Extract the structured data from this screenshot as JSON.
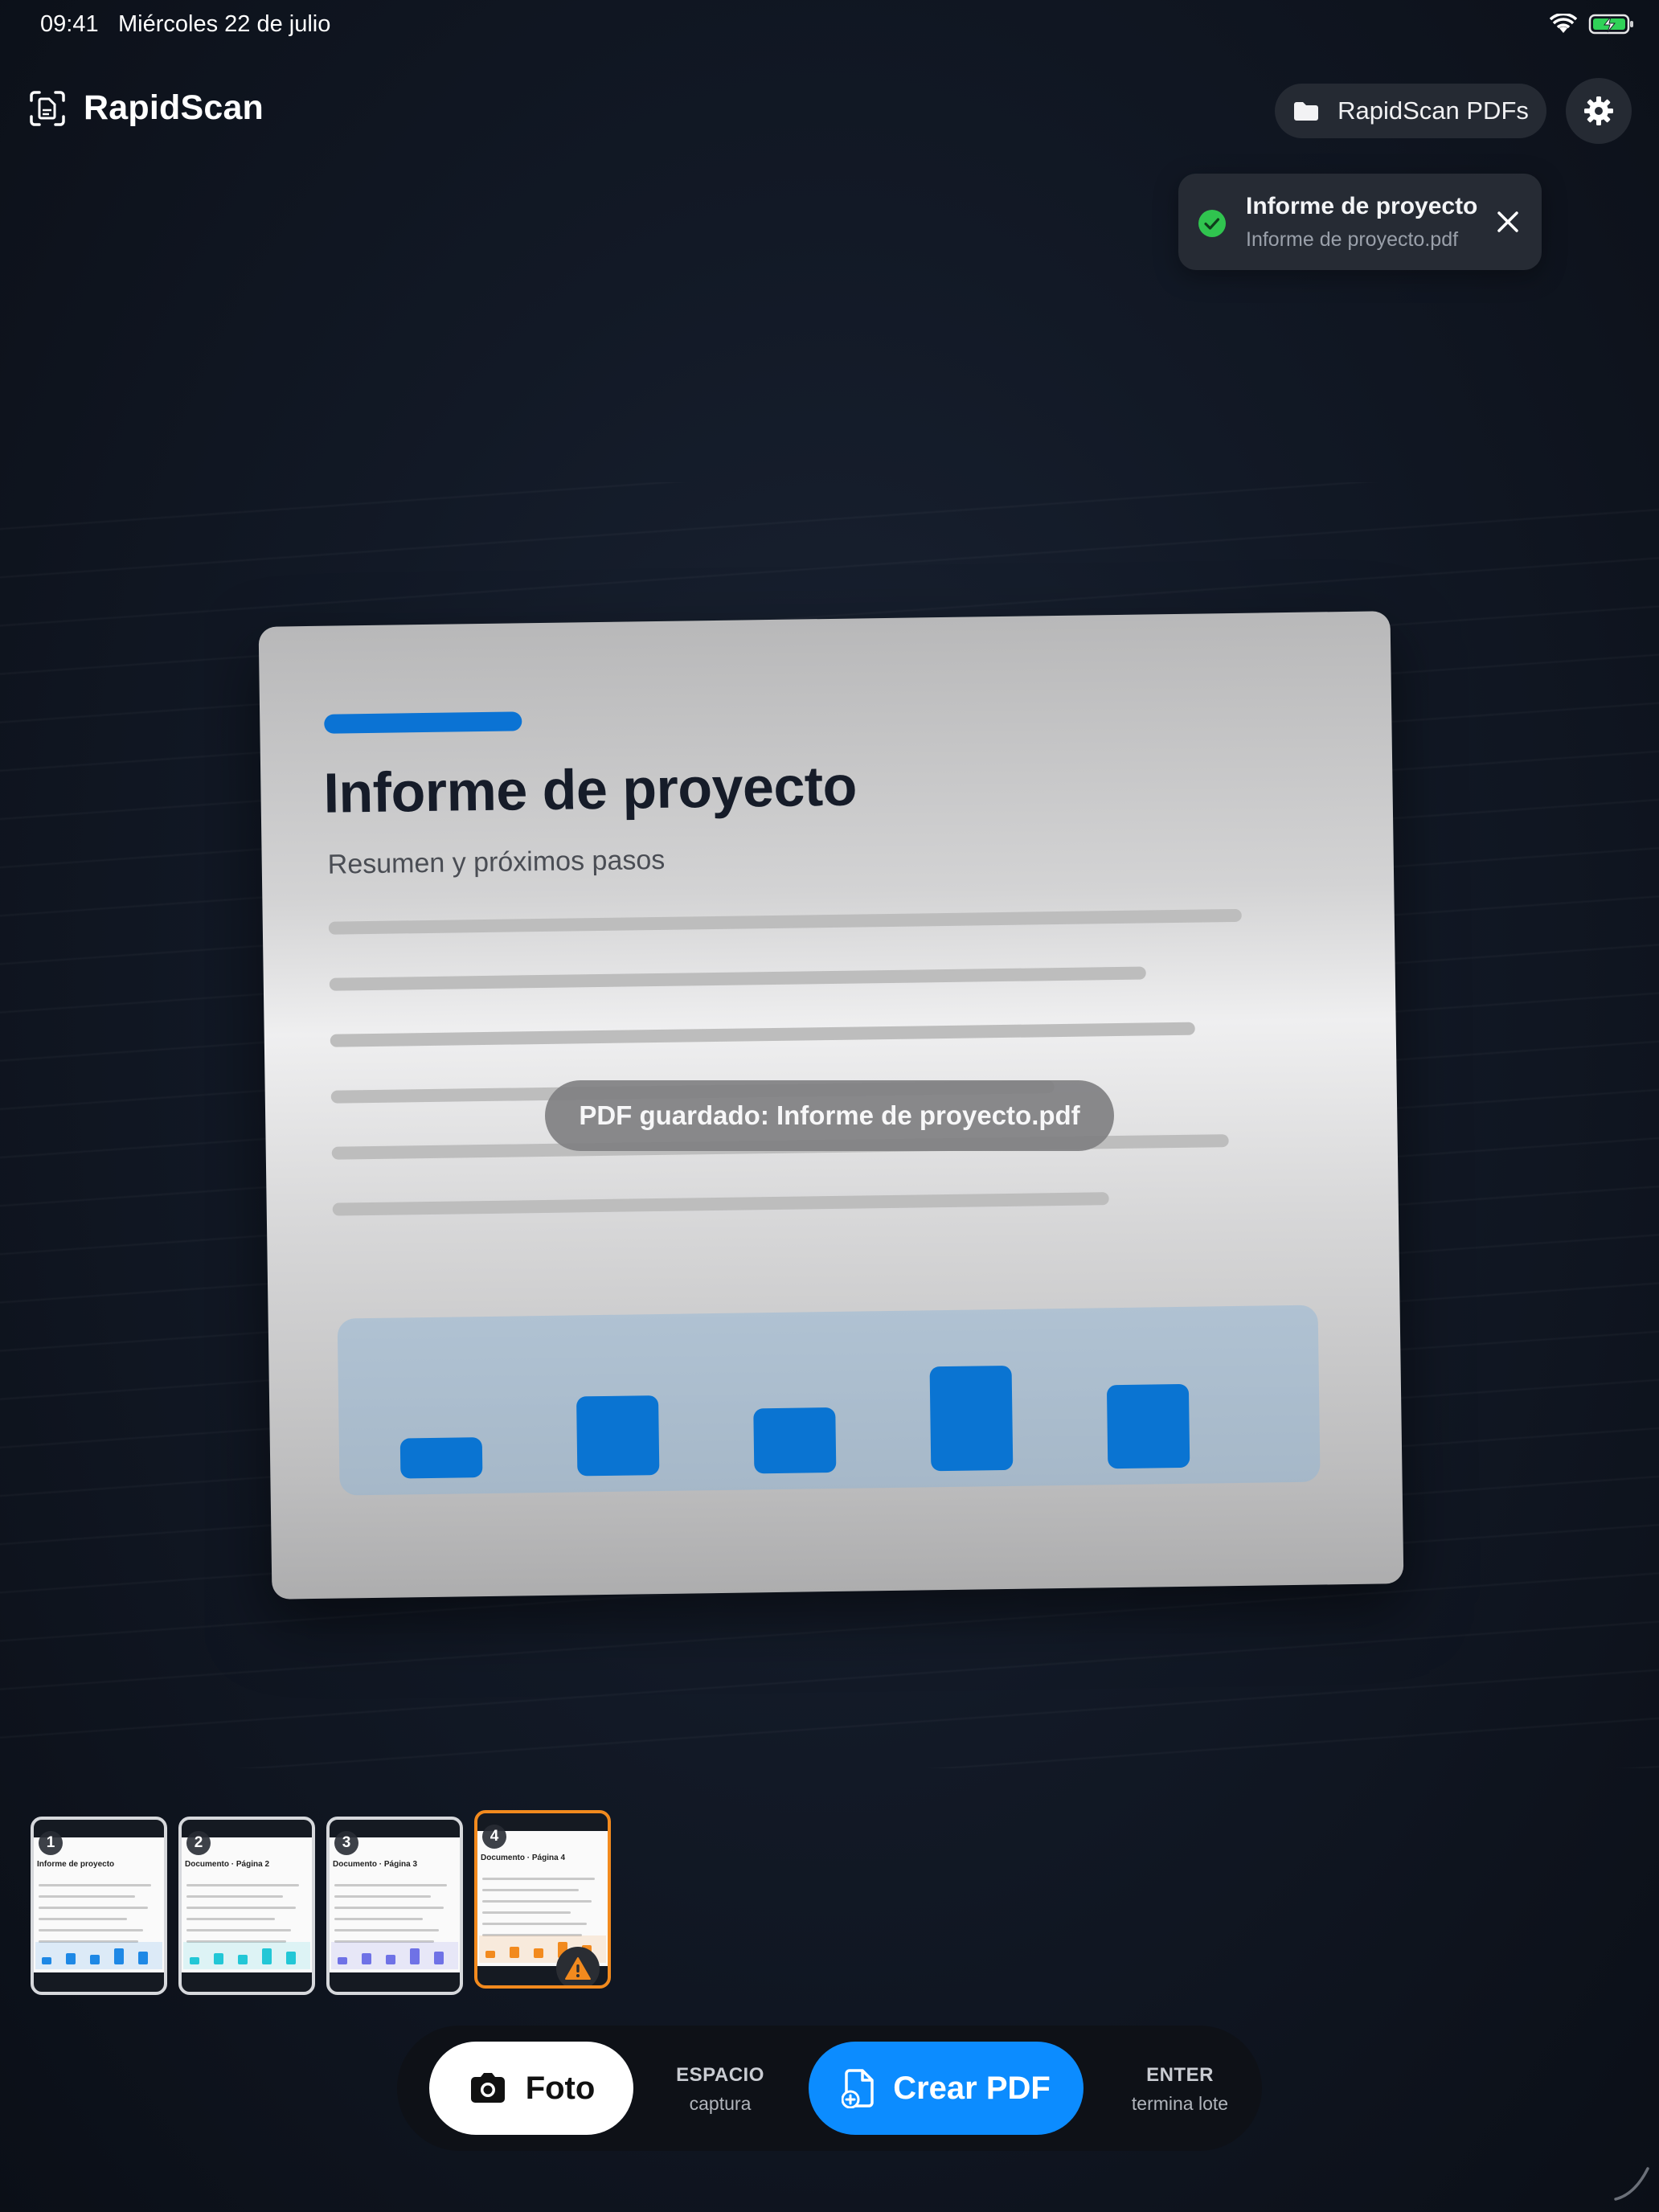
{
  "status_bar": {
    "time": "09:41",
    "date": "Miércoles 22 de julio"
  },
  "header": {
    "app_name": "RapidScan",
    "folder_button": "RapidScan PDFs"
  },
  "notification": {
    "title": "Informe de proyecto",
    "subtitle": "Informe de proyecto.pdf"
  },
  "document": {
    "title": "Informe de proyecto",
    "subtitle": "Resumen y próximos pasos",
    "accent_color": "#0b73d4",
    "chart_levels": [
      0.28,
      0.55,
      0.45,
      0.72,
      0.58
    ]
  },
  "toast": {
    "message": "PDF guardado: Informe de proyecto.pdf"
  },
  "thumbnails": [
    {
      "number": "1",
      "title": "Informe de proyecto",
      "color": "#1e88e5"
    },
    {
      "number": "2",
      "title": "Documento · Página 2",
      "color": "#22c7d6"
    },
    {
      "number": "3",
      "title": "Documento · Página 3",
      "color": "#6f72e6"
    },
    {
      "number": "4",
      "title": "Documento · Página 4",
      "color": "#f28a1e",
      "selected": true,
      "warning": true
    }
  ],
  "toolbar": {
    "photo_label": "Foto",
    "space_key": "ESPACIO",
    "space_action": "captura",
    "create_pdf_label": "Crear PDF",
    "enter_key": "ENTER",
    "enter_action": "termina lote"
  }
}
